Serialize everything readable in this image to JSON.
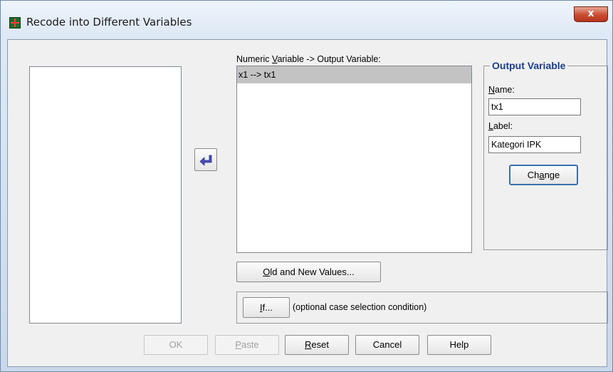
{
  "window": {
    "title": "Recode into Different Variables",
    "close_glyph": "x"
  },
  "source_list": {
    "items": []
  },
  "move_button": {
    "icon": "arrow-left-icon"
  },
  "mapping": {
    "label_pre": "Numeric ",
    "label_mnemonic": "V",
    "label_post": "ariable -> Output Variable:",
    "items": [
      "x1 --> tx1"
    ]
  },
  "output_variable": {
    "title": "Output Variable",
    "name_mnemonic": "N",
    "name_rest": "ame:",
    "name_value": "tx1",
    "label_mnemonic": "L",
    "label_rest": "abel:",
    "label_value": "Kategori IPK",
    "change_pre": "Ch",
    "change_mnemonic": "a",
    "change_post": "nge"
  },
  "old_new_button": {
    "mnemonic": "O",
    "rest": "ld and New Values..."
  },
  "if_button": {
    "mnemonic": "I",
    "rest": "f..."
  },
  "if_hint": "(optional case selection condition)",
  "buttons": {
    "ok": "OK",
    "paste_mnemonic": "P",
    "paste_rest": "aste",
    "reset_mnemonic": "R",
    "reset_rest": "eset",
    "cancel": "Cancel",
    "help": "Help"
  }
}
